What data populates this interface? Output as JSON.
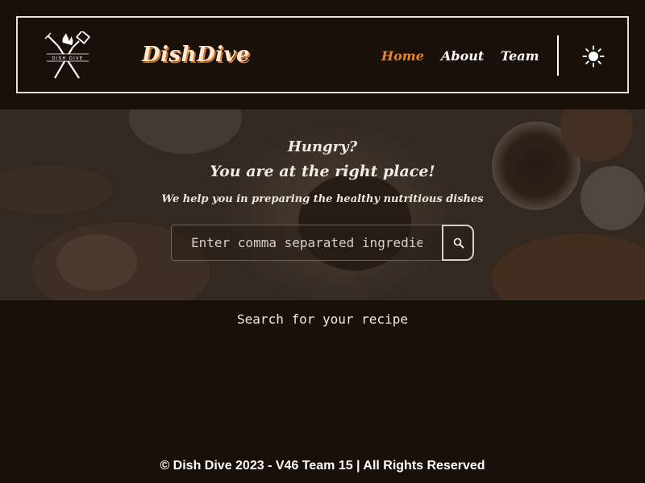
{
  "header": {
    "logo_text": "DISH DIVE",
    "brand": "DishDive",
    "nav": [
      {
        "label": "Home",
        "active": true
      },
      {
        "label": "About",
        "active": false
      },
      {
        "label": "Team",
        "active": false
      }
    ],
    "theme_icon": "sun-icon"
  },
  "hero": {
    "title_line1": "Hungry?",
    "title_line2": "You are at the right place!",
    "subtitle": "We help you in preparing the healthy nutritious dishes",
    "search": {
      "placeholder": "Enter comma separated ingredients",
      "value": "",
      "button_icon": "search-icon"
    }
  },
  "main": {
    "prompt": "Search for your recipe"
  },
  "footer": {
    "text": "© Dish Dive 2023 - V46 Team 15 | All Rights Reserved"
  },
  "colors": {
    "background": "#1a100a",
    "accent": "#e8822b",
    "brand_shadow": "#d9741e"
  }
}
